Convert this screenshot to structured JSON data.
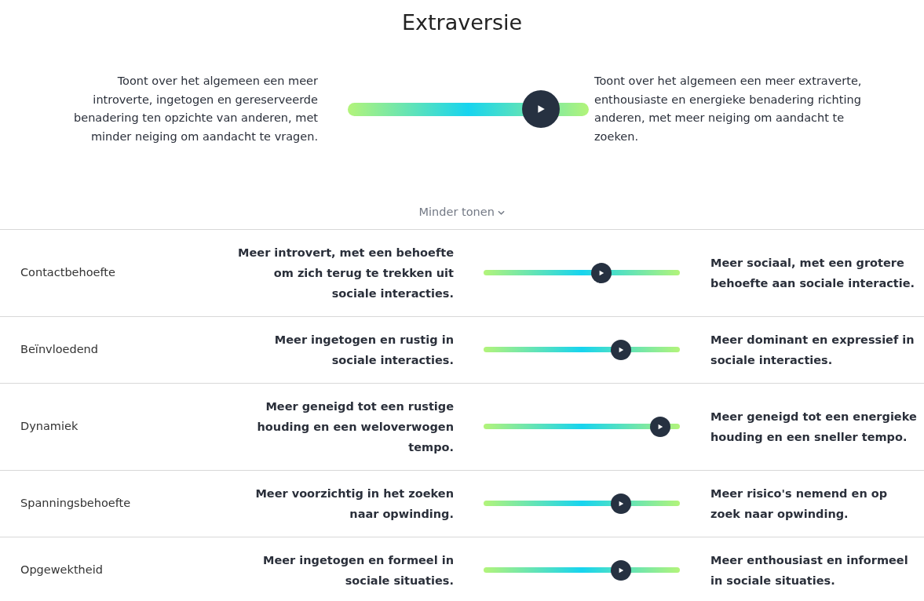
{
  "title": "Extraversie",
  "summary": {
    "left": "Toont over het algemeen een meer introverte, ingetogen en gereserveerde benadering ten opzichte van anderen, met minder neiging om aandacht te vragen.",
    "right": "Toont over het algemeen een meer extraverte, enthousiaste en energieke benadering richting anderen, met meer neiging om aandacht te zoeken.",
    "level": 0.8
  },
  "toggle": {
    "label": "Minder tonen",
    "expanded": true
  },
  "facets": [
    {
      "name": "Contactbehoefte",
      "left": "Meer introvert, met een behoefte om zich terug te trekken uit sociale interacties.",
      "right": "Meer sociaal, met een grotere behoefte aan sociale interactie.",
      "level": 0.6
    },
    {
      "name": "Beïnvloedend",
      "left": "Meer ingetogen en rustig in sociale interacties.",
      "right": "Meer dominant en expressief in sociale interacties.",
      "level": 0.7
    },
    {
      "name": "Dynamiek",
      "left": "Meer geneigd tot een rustige houding en een weloverwogen tempo.",
      "right": "Meer geneigd tot een energieke houding en een sneller tempo.",
      "level": 0.9
    },
    {
      "name": "Spanningsbehoefte",
      "left": "Meer voorzichtig in het zoeken naar opwinding.",
      "right": "Meer risico's nemend en op zoek naar opwinding.",
      "level": 0.7
    },
    {
      "name": "Opgewektheid",
      "left": "Meer ingetogen en formeel in sociale situaties.",
      "right": "Meer enthousiast en informeel in sociale situaties.",
      "level": 0.7
    }
  ]
}
